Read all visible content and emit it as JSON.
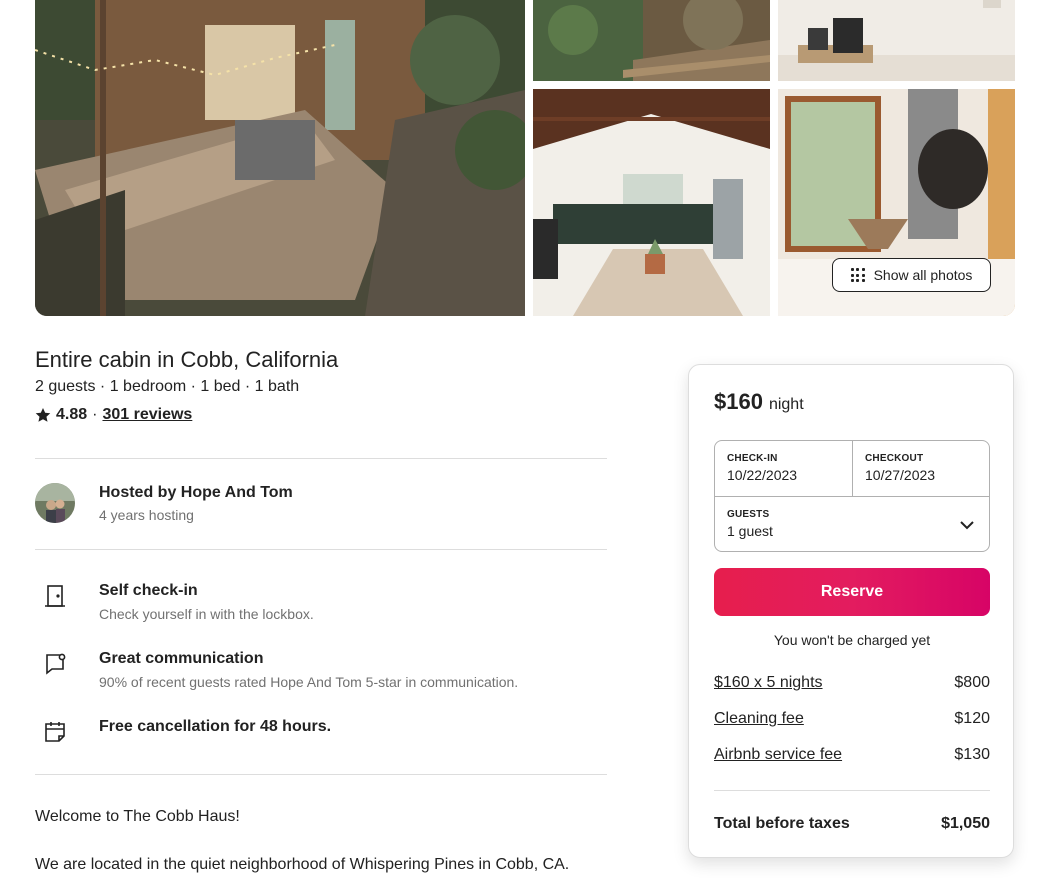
{
  "gallery": {
    "show_all_label": "Show all photos",
    "show_all_icon": "grid-dots-icon"
  },
  "listing": {
    "title": "Entire cabin in Cobb, California",
    "details": "2 guests · 1 bedroom · 1 bed · 1 bath",
    "rating": "4.88",
    "rating_sep": "·",
    "reviews_label": "301 reviews"
  },
  "host": {
    "name": "Hosted by Hope And Tom",
    "tenure": "4 years hosting"
  },
  "highlights": [
    {
      "icon": "door-icon",
      "title": "Self check-in",
      "desc": "Check yourself in with the lockbox."
    },
    {
      "icon": "chat-bubble-icon",
      "title": "Great communication",
      "desc": "90% of recent guests rated Hope And Tom 5-star in communication."
    },
    {
      "icon": "calendar-icon",
      "title": "Free cancellation for 48 hours.",
      "desc": ""
    }
  ],
  "description": {
    "line1": "Welcome to The Cobb Haus!",
    "line2": "We are located in the quiet neighborhood of Whispering Pines in Cobb, CA."
  },
  "booking": {
    "price": "$160",
    "per": "night",
    "checkin_label": "CHECK-IN",
    "checkin_value": "10/22/2023",
    "checkout_label": "CHECKOUT",
    "checkout_value": "10/27/2023",
    "guests_label": "GUESTS",
    "guests_value": "1 guest",
    "reserve_label": "Reserve",
    "not_charged": "You won't be charged yet",
    "fees": [
      {
        "label": "$160 x 5 nights",
        "amount": "$800"
      },
      {
        "label": "Cleaning fee",
        "amount": "$120"
      },
      {
        "label": "Airbnb service fee",
        "amount": "$130"
      }
    ],
    "total_label": "Total before taxes",
    "total_amount": "$1,050"
  },
  "colors": {
    "brand": "#e31c5f",
    "text": "#222222",
    "muted": "#717171",
    "border": "#dddddd"
  }
}
